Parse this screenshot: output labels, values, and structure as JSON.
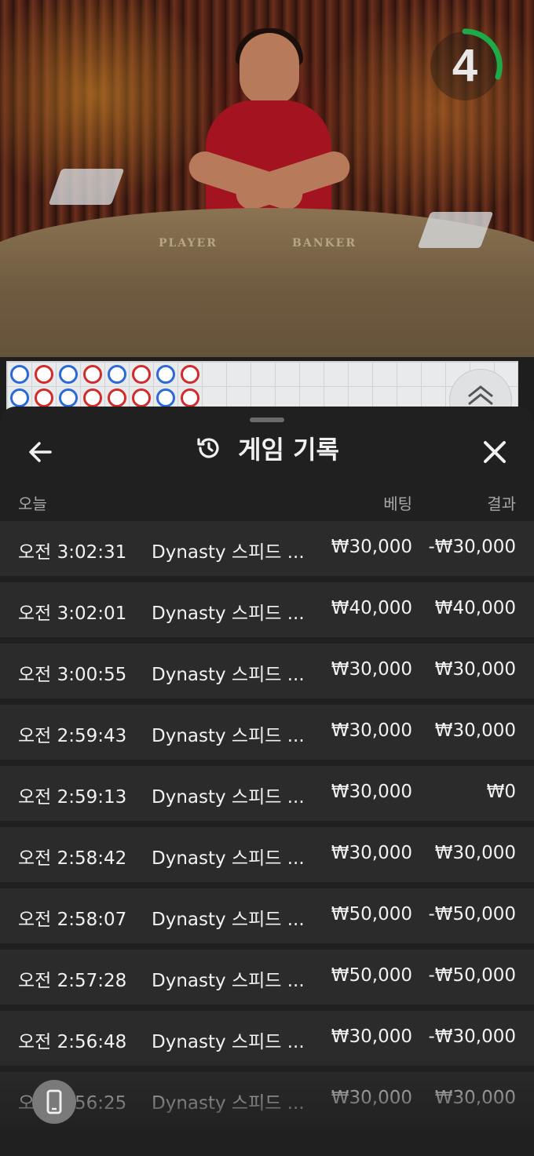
{
  "video": {
    "felt_left_label": "PLAYER",
    "felt_right_label": "BANKER",
    "countdown": "4"
  },
  "roadmap": {
    "top_row": [
      "blue",
      "red",
      "blue",
      "red",
      "blue",
      "red",
      "blue",
      "red"
    ],
    "bottom_row": [
      "blue",
      "red",
      "blue",
      "red",
      "red",
      "red",
      "blue",
      "red"
    ]
  },
  "panel": {
    "title": "게임 기록",
    "title_icon": "history-icon",
    "back_icon": "arrow-left-icon",
    "close_icon": "close-icon",
    "columns": {
      "date": "오늘",
      "bet": "베팅",
      "result": "결과"
    },
    "rows": [
      {
        "time": "오전 3:02:31",
        "game": "Dynasty 스피드 ...",
        "bet": "₩30,000",
        "result": "-₩30,000"
      },
      {
        "time": "오전 3:02:01",
        "game": "Dynasty 스피드 ...",
        "bet": "₩40,000",
        "result": "₩40,000"
      },
      {
        "time": "오전 3:00:55",
        "game": "Dynasty 스피드 ...",
        "bet": "₩30,000",
        "result": "₩30,000"
      },
      {
        "time": "오전 2:59:43",
        "game": "Dynasty 스피드 ...",
        "bet": "₩30,000",
        "result": "₩30,000"
      },
      {
        "time": "오전 2:59:13",
        "game": "Dynasty 스피드 ...",
        "bet": "₩30,000",
        "result": "₩0"
      },
      {
        "time": "오전 2:58:42",
        "game": "Dynasty 스피드 ...",
        "bet": "₩30,000",
        "result": "₩30,000"
      },
      {
        "time": "오전 2:58:07",
        "game": "Dynasty 스피드 ...",
        "bet": "₩50,000",
        "result": "-₩50,000"
      },
      {
        "time": "오전 2:57:28",
        "game": "Dynasty 스피드 ...",
        "bet": "₩50,000",
        "result": "-₩50,000"
      },
      {
        "time": "오전 2:56:48",
        "game": "Dynasty 스피드 ...",
        "bet": "₩30,000",
        "result": "-₩30,000"
      },
      {
        "time": "오전 2:56:25",
        "game": "Dynasty 스피드 ...",
        "bet": "₩30,000",
        "result": "₩30,000"
      }
    ]
  },
  "colors": {
    "panel_bg": "#202020",
    "row_bg": "#2b2b2b",
    "timer_green": "#1faa4a",
    "player_blue": "#2a69d6",
    "banker_red": "#d12b2b"
  }
}
